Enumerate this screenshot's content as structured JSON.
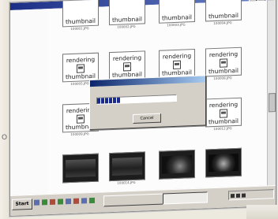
{
  "window": {
    "title": ""
  },
  "folder_pane": {
    "label_line1": "",
    "label_line2": ""
  },
  "thumb_rows": [
    {
      "placeholder_bottom": "thumbnail",
      "captions": [
        "100001.JPG",
        "100002.JPG",
        "100003.JPG",
        "100004.JPG"
      ]
    },
    {
      "placeholder_top": "rendering",
      "placeholder_bottom": "thumbnail",
      "captions": [
        "100005.JPG",
        "100006.JPG",
        "100007.JPG",
        "100008.JPG"
      ]
    },
    {
      "placeholder_top": "rendering",
      "placeholder_bottom": "thumbnail",
      "captions": [
        "100009.JPG",
        "",
        "",
        "100012.JPG"
      ]
    },
    {
      "captions": [
        "",
        "100014.JPG",
        "",
        ""
      ]
    }
  ],
  "dialog": {
    "title": "",
    "filename": "",
    "progress": 0.3,
    "cancel_label": "Cancel"
  },
  "taskbar": {
    "start_label": "Start",
    "task_main": "",
    "task_active": "",
    "clock": ""
  },
  "page": {
    "stray_text": "O",
    "corner_text": ""
  },
  "colors": {
    "titlebar_start": "#1c2f86",
    "dialog_title_start": "#0a246a",
    "progress_fill": "#1a2a8a"
  }
}
